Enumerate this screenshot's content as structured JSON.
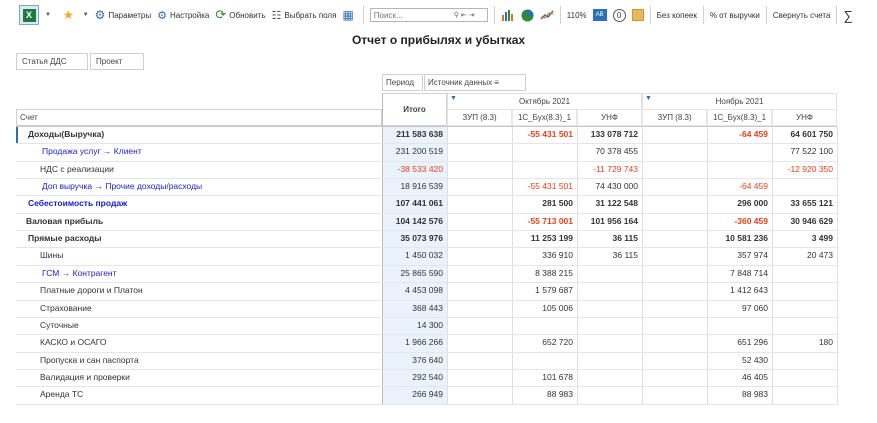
{
  "toolbar": {
    "params_label": "Параметры",
    "settings_label": "Настройка",
    "refresh_label": "Обновить",
    "fields_label": "Выбрать поля",
    "search_placeholder": "Поиск...",
    "zoom": "110%",
    "no_kopecks_label": "Без копеек",
    "percent_revenue_label": "% от выручки",
    "collapse_accounts_label": "Свернуть счета",
    "sum_label": "∑"
  },
  "report_title": "Отчет о прибылях и убытках",
  "filters": [
    "Статья ДДС",
    "Проект"
  ],
  "column_filters": {
    "period": "Период",
    "source": "Источник данных"
  },
  "header": {
    "account": "Счет",
    "total": "Итого",
    "months": [
      {
        "label": "Октябрь 2021",
        "sources": [
          "ЗУП (8.3)",
          "1С_Бух(8.3)_1",
          "УНФ"
        ]
      },
      {
        "label": "Ноябрь 2021",
        "sources": [
          "ЗУП (8.3)",
          "1С_Бух(8.3)_1",
          "УНФ"
        ]
      }
    ]
  },
  "rows": [
    {
      "name": "Доходы(Выручка)",
      "style": "bold",
      "indent": 0,
      "total": "211 583 638",
      "vals": [
        "",
        "-55 431 501",
        "133 078 712",
        "",
        "-64 459",
        "64 601 750"
      ]
    },
    {
      "name": "Продажа услуг → Клиент",
      "style": "link",
      "indent": 2,
      "total": "231 200 519",
      "vals": [
        "",
        "",
        "70 378 455",
        "",
        "",
        "77 522 100"
      ]
    },
    {
      "name": "НДС с реализации",
      "style": "normal",
      "indent": 1,
      "total": "-38 533 420",
      "vals": [
        "",
        "",
        "-11 729 743",
        "",
        "",
        "-12 920 350"
      ]
    },
    {
      "name": "Доп выручка → Прочие доходы/расходы",
      "style": "link",
      "indent": 2,
      "total": "18 916 539",
      "vals": [
        "",
        "-55 431 501",
        "74 430 000",
        "",
        "-64 459",
        ""
      ]
    },
    {
      "name": "Себестоимость продаж",
      "style": "bluebold",
      "indent": 0,
      "total": "107 441 061",
      "vals": [
        "",
        "281 500",
        "31 122 548",
        "",
        "296 000",
        "33 655 121"
      ]
    },
    {
      "name": "Валовая прибыль",
      "style": "bold",
      "indent": -1,
      "total": "104 142 576",
      "vals": [
        "",
        "-55 713 001",
        "101 956 164",
        "",
        "-360 459",
        "30 946 629"
      ]
    },
    {
      "name": "Прямые расходы",
      "style": "bold",
      "indent": 0,
      "total": "35 073 976",
      "vals": [
        "",
        "11 253 199",
        "36 115",
        "",
        "10 581 236",
        "3 499"
      ]
    },
    {
      "name": "Шины",
      "style": "normal",
      "indent": 1,
      "total": "1 450 032",
      "vals": [
        "",
        "336 910",
        "36 115",
        "",
        "357 974",
        "20 473"
      ]
    },
    {
      "name": "ГСМ → Контрагент",
      "style": "link",
      "indent": 2,
      "total": "25 865 590",
      "vals": [
        "",
        "8 388 215",
        "",
        "",
        "7 848 714",
        ""
      ]
    },
    {
      "name": "Платные дороги и Платон",
      "style": "normal",
      "indent": 1,
      "total": "4 453 098",
      "vals": [
        "",
        "1 579 687",
        "",
        "",
        "1 412 643",
        ""
      ]
    },
    {
      "name": "Страхование",
      "style": "normal",
      "indent": 1,
      "total": "368 443",
      "vals": [
        "",
        "105 006",
        "",
        "",
        "97 060",
        ""
      ]
    },
    {
      "name": "Суточные",
      "style": "normal",
      "indent": 1,
      "total": "14 300",
      "vals": [
        "",
        "",
        "",
        "",
        "",
        ""
      ]
    },
    {
      "name": "КАСКО и ОСАГО",
      "style": "normal",
      "indent": 1,
      "total": "1 966 266",
      "vals": [
        "",
        "652 720",
        "",
        "",
        "651 296",
        "180"
      ]
    },
    {
      "name": "Пропуска и сан паспорта",
      "style": "normal",
      "indent": 1,
      "total": "376 640",
      "vals": [
        "",
        "",
        "",
        "",
        "52 430",
        ""
      ]
    },
    {
      "name": "Валидация и проверки",
      "style": "normal",
      "indent": 1,
      "total": "292 540",
      "vals": [
        "",
        "101 678",
        "",
        "",
        "46 405",
        ""
      ]
    },
    {
      "name": "Аренда ТС",
      "style": "normal",
      "indent": 1,
      "total": "266 949",
      "vals": [
        "",
        "88 983",
        "",
        "",
        "88 983",
        ""
      ]
    }
  ],
  "colors": {
    "negative": "#e8401c",
    "link": "#2222cc",
    "total_bg": "#eaf2fb"
  }
}
